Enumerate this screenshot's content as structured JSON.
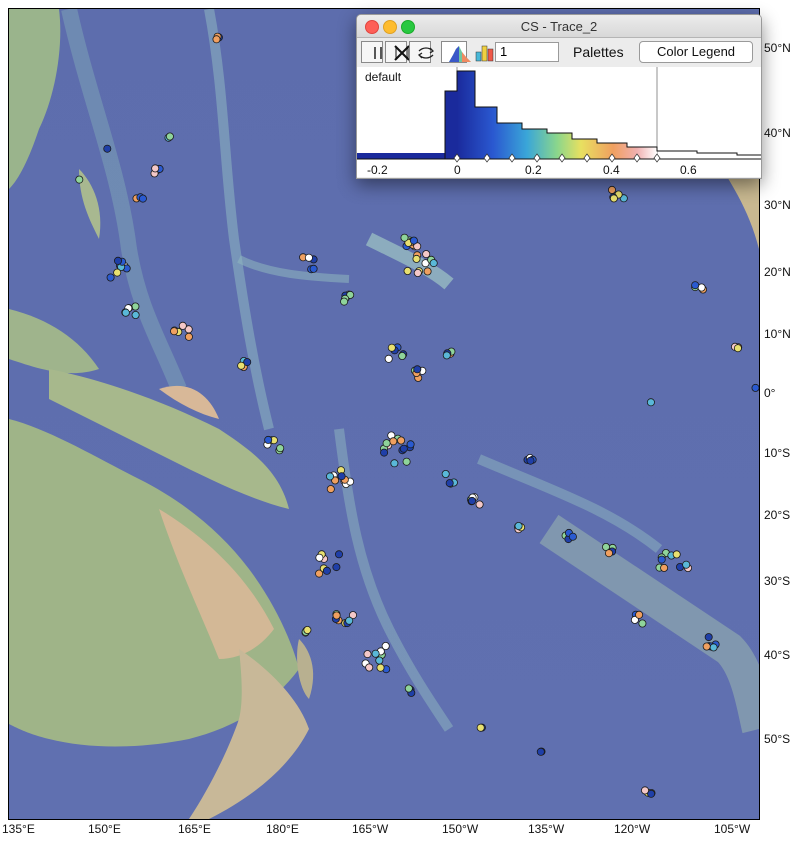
{
  "window": {
    "title": "CS - Trace_2",
    "value_field": "1",
    "palettes_label": "Palettes",
    "color_legend_label": "Color Legend",
    "palette_name": "default",
    "axis_ticks": [
      "-0.2",
      "0",
      "0.2",
      "0.4",
      "0.6"
    ],
    "icons": [
      "pause-icon",
      "cross-x-icon",
      "swap-arrows-icon",
      "histogram-mountain-icon",
      "histogram-bars-icon"
    ]
  },
  "map": {
    "lat_labels": [
      "50°N",
      "40°N",
      "30°N",
      "20°N",
      "10°N",
      "0°",
      "10°S",
      "20°S",
      "30°S",
      "40°S",
      "50°S"
    ],
    "lon_labels": [
      "135°E",
      "150°E",
      "165°E",
      "180°E",
      "165°W",
      "150°W",
      "135°W",
      "120°W",
      "105°W"
    ],
    "colors": {
      "ocean_deep": "#4a5a9c",
      "ocean_shelf": "#8fb8c0",
      "land_low": "#9ab388",
      "land_high": "#d8b898"
    }
  }
}
